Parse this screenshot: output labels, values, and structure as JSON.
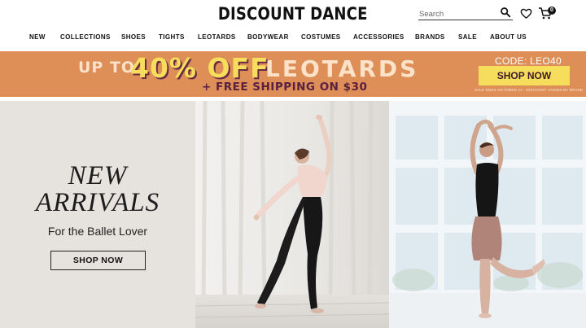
{
  "header": {
    "logo": "DISCOUNT DANCE",
    "search_placeholder": "Search",
    "cart_count": "0"
  },
  "nav": {
    "items": [
      "NEW",
      "COLLECTIONS",
      "SHOES",
      "TIGHTS",
      "LEOTARDS",
      "BODYWEAR",
      "COSTUMES",
      "ACCESSORIES",
      "BRANDS",
      "SALE",
      "ABOUT US"
    ]
  },
  "promo": {
    "up_to": "UP TO",
    "percent": "40% OFF",
    "category": "LEOTARDS",
    "shipping": "+ FREE SHIPPING ON $30",
    "code": "CODE: LEO40",
    "button": "SHOP NOW",
    "fine_print": "SALE ENDS OCTOBER 12  ·  DISCOUNT VARIES BY BRAND",
    "colors": {
      "background": "#dd8f57",
      "accent": "#f6dd5c",
      "plum": "#5a2042"
    }
  },
  "hero": {
    "title_line1": "NEW",
    "title_line2": "ARRIVALS",
    "subtitle": "For the Ballet Lover",
    "button": "SHOP NOW"
  }
}
